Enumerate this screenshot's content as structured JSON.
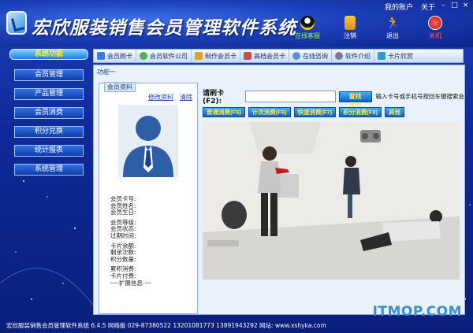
{
  "header": {
    "title": "宏欣服装销售会员管理软件系统",
    "top_links": [
      "我的账户",
      "关于"
    ],
    "window_controls": [
      "–",
      "□",
      "×"
    ],
    "buttons": [
      {
        "label": "在线客服",
        "icon": "qq-icon"
      },
      {
        "label": "注销",
        "icon": "lock-icon"
      },
      {
        "label": "退出",
        "icon": "running-man-icon"
      },
      {
        "label": "关机",
        "icon": "power-icon"
      }
    ]
  },
  "nav": {
    "header": "系统功能",
    "items": [
      "会员管理",
      "产品管理",
      "会员消费",
      "积分兑换",
      "统计报表",
      "系统管理"
    ]
  },
  "toolbar": {
    "items": [
      {
        "label": "会员刷卡",
        "icon": "card-icon"
      },
      {
        "label": "会员软件公司",
        "icon": "people-icon"
      },
      {
        "label": "制作会员卡",
        "icon": "card-make-icon"
      },
      {
        "label": "高档会员卡",
        "icon": "premium-card-icon"
      },
      {
        "label": "在线咨询",
        "icon": "chat-icon"
      },
      {
        "label": "软件介绍",
        "icon": "gear-icon"
      },
      {
        "label": "卡片欣赏",
        "icon": "gallery-icon"
      }
    ]
  },
  "content": {
    "func_tab": "功能一",
    "member_panel": {
      "title": "会员资料",
      "links": [
        "修改资料",
        "清除"
      ],
      "fields": [
        "会员卡号:",
        "会员姓名:",
        "会员生日:",
        "",
        "会员等级:",
        "会员状态:",
        "过期时间:",
        "",
        "卡片余额:",
        "剩余次数:",
        "积分数量:",
        "",
        "累积消费:",
        "卡片付费:",
        "----扩展信息----"
      ]
    },
    "card": {
      "label": "请刷卡(F2):",
      "value": "",
      "search_label": "查找(F3)",
      "hint": "输入卡号或手机号按回车键搜索会"
    },
    "consume_buttons": [
      "普通消费(F5)",
      "计次消费(F6)",
      "快速消费(F7)",
      "积分消费(F8)",
      "其他"
    ]
  },
  "statusbar": {
    "text": "宏欣服装销售会员管理软件系统 6.4.5 网络版 029-87380522 13201081773 13891943292 网站: www.xshyka.com"
  },
  "watermark": "ITMOP.COM",
  "colors": {
    "accent": "#1b3fb8",
    "button_text": "#ffe93a",
    "status_green": "#8cff3c"
  }
}
